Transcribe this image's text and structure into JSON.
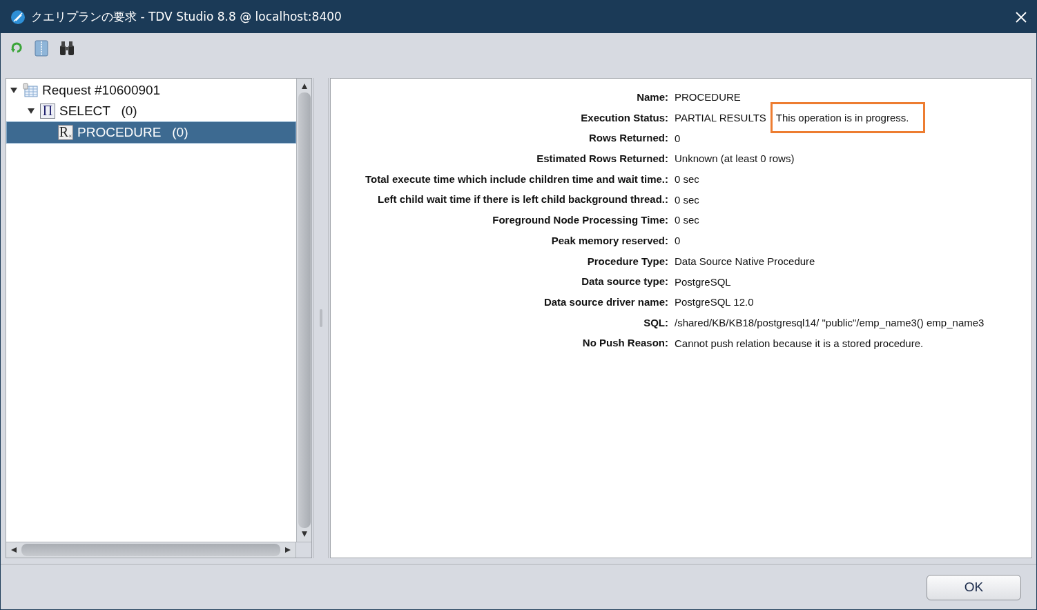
{
  "window": {
    "title": "クエリプランの要求 - TDV Studio 8.8 @ localhost:8400"
  },
  "tree": [
    {
      "label": "Request #10600901",
      "kind": "request",
      "expanded": true,
      "selected": false,
      "children": [
        {
          "label": "SELECT   (0)",
          "kind": "operator",
          "glyph": "Π",
          "expanded": true,
          "selected": false,
          "children": [
            {
              "label": "PROCEDURE   (0)",
              "kind": "procedure",
              "glyph": "R",
              "sub": "×",
              "selected": true
            }
          ]
        }
      ]
    }
  ],
  "details": [
    {
      "label": "Name:",
      "value": "PROCEDURE"
    },
    {
      "label": "Execution Status:",
      "value": "PARTIAL RESULTS",
      "note": "This operation is in progress.",
      "note_highlighted": true
    },
    {
      "label": "Rows Returned:",
      "value": "0"
    },
    {
      "label": "Estimated Rows Returned:",
      "value": "Unknown (at least 0 rows)"
    },
    {
      "label": "Total execute time which include children time and wait time.:",
      "value": "0 sec"
    },
    {
      "label": "Left child wait time if there is left child background thread.:",
      "value": "0 sec"
    },
    {
      "label": "Foreground Node Processing Time:",
      "value": "0 sec"
    },
    {
      "label": "Peak memory reserved:",
      "value": "0"
    },
    {
      "label": "Procedure Type:",
      "value": "Data Source Native Procedure"
    },
    {
      "label": "Data source type:",
      "value": "PostgreSQL"
    },
    {
      "label": "Data source driver name:",
      "value": "PostgreSQL 12.0"
    },
    {
      "label": "SQL:",
      "value": "/shared/KB/KB18/postgresql14/ \"public\"/emp_name3() emp_name3"
    },
    {
      "label": "No Push Reason:",
      "value": "Cannot push relation because it is a stored procedure."
    }
  ],
  "buttons": [
    "OK"
  ]
}
